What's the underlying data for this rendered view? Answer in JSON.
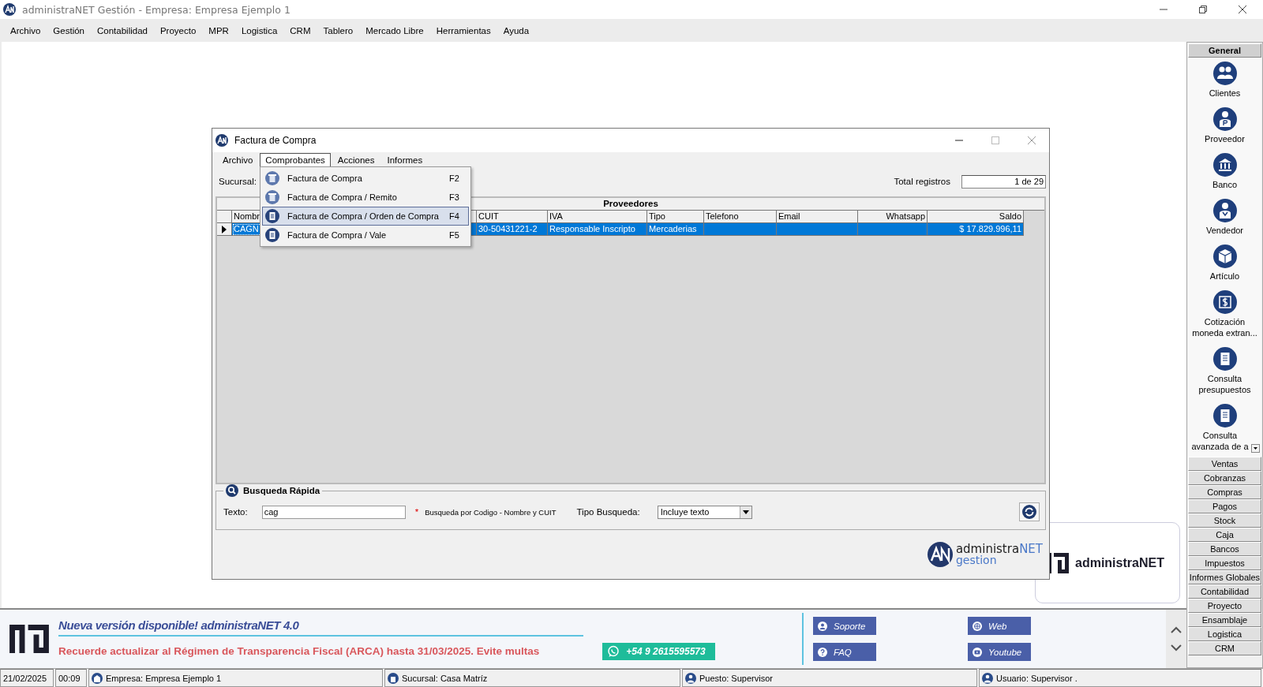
{
  "app": {
    "title": "administraNET Gestión - Empresa: Empresa Ejemplo 1"
  },
  "menu": [
    "Archivo",
    "Gestión",
    "Contabilidad",
    "Proyecto",
    "MPR",
    "Logistica",
    "CRM",
    "Tablero",
    "Mercado Libre",
    "Herramientas",
    "Ayuda"
  ],
  "dialog": {
    "title": "Factura de Compra",
    "menu": [
      {
        "label": "Archivo",
        "selected": false
      },
      {
        "label": "Comprobantes",
        "selected": true
      },
      {
        "label": "Acciones",
        "selected": false
      },
      {
        "label": "Informes",
        "selected": false
      }
    ],
    "dropdown": [
      {
        "label": "Factura de Compra",
        "shortcut": "F2",
        "selected": false,
        "kind": "afip"
      },
      {
        "label": "Factura de Compra / Remito",
        "shortcut": "F3",
        "selected": false,
        "kind": "afip"
      },
      {
        "label": "Factura de Compra / Orden de Compra",
        "shortcut": "F4",
        "selected": true,
        "kind": "doc"
      },
      {
        "label": "Factura de Compra / Vale",
        "shortcut": "F5",
        "selected": false,
        "kind": "doc"
      }
    ],
    "branch_label": "Sucursal:",
    "total_label": "Total registros",
    "total_value": "1 de 29",
    "grid": {
      "title": "Proveedores",
      "columns": [
        "Nombr",
        "",
        "CUIT",
        "IVA",
        "Tipo",
        "Telefono",
        "Email",
        "Whatsapp",
        "Saldo"
      ],
      "rows": [
        {
          "selected": true,
          "cells": [
            "CAGN",
            "",
            "30-50431221-2",
            "Responsable Inscripto",
            "Mercaderias",
            "",
            "",
            "",
            "$ 17.829.996,11"
          ]
        }
      ]
    },
    "search": {
      "title": "Busqueda Rápida",
      "text_label": "Texto:",
      "text_value": "cag",
      "required_mark": "*",
      "hint": "Busqueda por Codigo - Nombre y CUIT",
      "type_label": "Tipo Busqueda:",
      "type_value": "Incluye texto"
    },
    "logo": {
      "name": "administra",
      "name_accent": "NET",
      "subtitle": "gestion"
    }
  },
  "background_logo": "administraNET",
  "sidebar": [
    {
      "label": "General",
      "expanded": true,
      "items": [
        {
          "label": "Clientes",
          "kind": "people"
        },
        {
          "label": "Proveedor",
          "kind": "supplier"
        },
        {
          "label": "Banco",
          "kind": "bank"
        },
        {
          "label": "Vendedor",
          "kind": "seller"
        },
        {
          "label": "Artículo",
          "kind": "box"
        },
        {
          "label": "Cotización moneda extran...",
          "kind": "currency"
        },
        {
          "label": "Consulta presupuestos",
          "kind": "doc"
        },
        {
          "label": "Consulta avanzada de a",
          "kind": "doc"
        }
      ]
    },
    {
      "label": "Ventas",
      "expanded": false
    },
    {
      "label": "Cobranzas",
      "expanded": false
    },
    {
      "label": "Compras",
      "expanded": false
    },
    {
      "label": "Pagos",
      "expanded": false
    },
    {
      "label": "Stock",
      "expanded": false
    },
    {
      "label": "Caja",
      "expanded": false
    },
    {
      "label": "Bancos",
      "expanded": false
    },
    {
      "label": "Impuestos",
      "expanded": false
    },
    {
      "label": "Informes Globales",
      "expanded": false
    },
    {
      "label": "Contabilidad",
      "expanded": false
    },
    {
      "label": "Proyecto",
      "expanded": false
    },
    {
      "label": "Ensamblaje",
      "expanded": false
    },
    {
      "label": "Logistica",
      "expanded": false
    },
    {
      "label": "CRM",
      "expanded": false
    }
  ],
  "banner": {
    "title": "Nueva versión disponible! administraNET 4.0",
    "notice": "Recuerde actualizar al Régimen de Transparencia Fiscal (ARCA) hasta 31/03/2025. Evite multas",
    "whatsapp": "+54 9 2615595573",
    "links": [
      {
        "label": "Soporte",
        "kind": "person"
      },
      {
        "label": "Web",
        "kind": "web"
      },
      {
        "label": "FAQ",
        "kind": "help"
      },
      {
        "label": "Youtube",
        "kind": "video"
      }
    ]
  },
  "status": [
    {
      "text": "21/02/2025",
      "kind": "plain"
    },
    {
      "text": "00:09",
      "kind": "plain"
    },
    {
      "text": "Empresa: Empresa Ejemplo 1",
      "kind": "company"
    },
    {
      "text": "Sucursal: Casa Matríz",
      "kind": "branch"
    },
    {
      "text": "Puesto: Supervisor",
      "kind": "user"
    },
    {
      "text": "Usuario: Supervisor .",
      "kind": "user"
    }
  ]
}
